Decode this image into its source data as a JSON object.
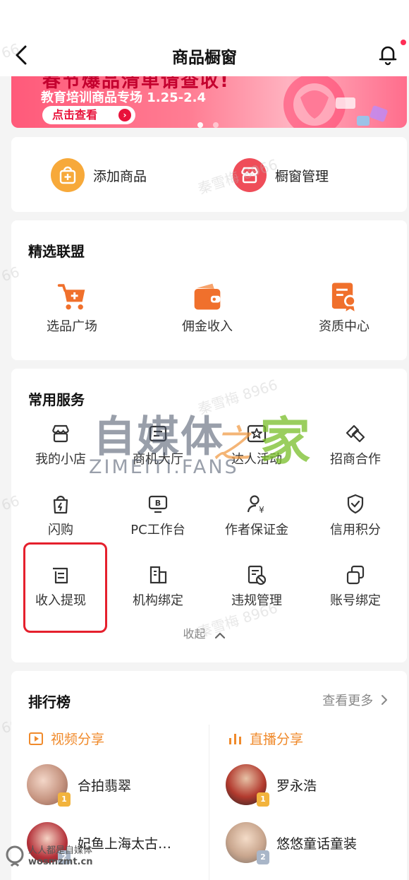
{
  "header": {
    "title": "商品橱窗"
  },
  "banner": {
    "headline": "春节爆品清单请查收!",
    "subtitle": "教育培训商品专场 1.25-2.4",
    "cta": "点击查看",
    "page_count": 2,
    "active_page": 1
  },
  "quick_actions": [
    {
      "label": "添加商品",
      "icon": "plus-bag-icon",
      "color": "#f7a93a"
    },
    {
      "label": "橱窗管理",
      "icon": "shop-icon",
      "color": "#ef4d59"
    }
  ],
  "alliance": {
    "title": "精选联盟",
    "items": [
      {
        "label": "选品广场",
        "icon": "cart-icon"
      },
      {
        "label": "佣金收入",
        "icon": "wallet-icon"
      },
      {
        "label": "资质中心",
        "icon": "certificate-icon"
      }
    ]
  },
  "services": {
    "title": "常用服务",
    "items": [
      {
        "label": "我的小店",
        "icon": "store-icon"
      },
      {
        "label": "商机大厅",
        "icon": "opportunity-icon"
      },
      {
        "label": "达人活动",
        "icon": "star-card-icon"
      },
      {
        "label": "招商合作",
        "icon": "handshake-icon"
      },
      {
        "label": "闪购",
        "icon": "flash-bag-icon"
      },
      {
        "label": "PC工作台",
        "icon": "monitor-icon"
      },
      {
        "label": "作者保证金",
        "icon": "deposit-icon"
      },
      {
        "label": "信用积分",
        "icon": "shield-check-icon"
      },
      {
        "label": "收入提现",
        "icon": "withdraw-icon"
      },
      {
        "label": "机构绑定",
        "icon": "building-icon"
      },
      {
        "label": "违规管理",
        "icon": "violation-icon"
      },
      {
        "label": "账号绑定",
        "icon": "link-accounts-icon"
      }
    ],
    "collapse_label": "收起"
  },
  "ranking": {
    "title": "排行榜",
    "more_label": "查看更多",
    "columns": [
      {
        "title": "视频分享",
        "icon": "play-box-icon",
        "entries": [
          {
            "rank": "1",
            "name": "合拍翡翠"
          },
          {
            "rank": "2",
            "name": "妃鱼上海太古…"
          }
        ]
      },
      {
        "title": "直播分享",
        "icon": "bars-icon",
        "entries": [
          {
            "rank": "1",
            "name": "罗永浩"
          },
          {
            "rank": "2",
            "name": "悠悠童话童装"
          }
        ]
      }
    ]
  },
  "watermark": {
    "logo_main": "自媒体",
    "logo_zhi": "之",
    "logo_home": "家",
    "logo_sub": "ZIMEITI.FANS",
    "faint_text": "秦雪梅 8966",
    "corner_num": "66",
    "footer_line1": "人人都是自媒体",
    "footer_line2": "wosmzmt.cn"
  },
  "colors": {
    "accent_orange": "#f0702c",
    "rank_orange": "#f08a2b",
    "highlight_red": "#e5202d",
    "gold_badge": "#f2b33d",
    "silver_badge": "#a9b6c8"
  }
}
